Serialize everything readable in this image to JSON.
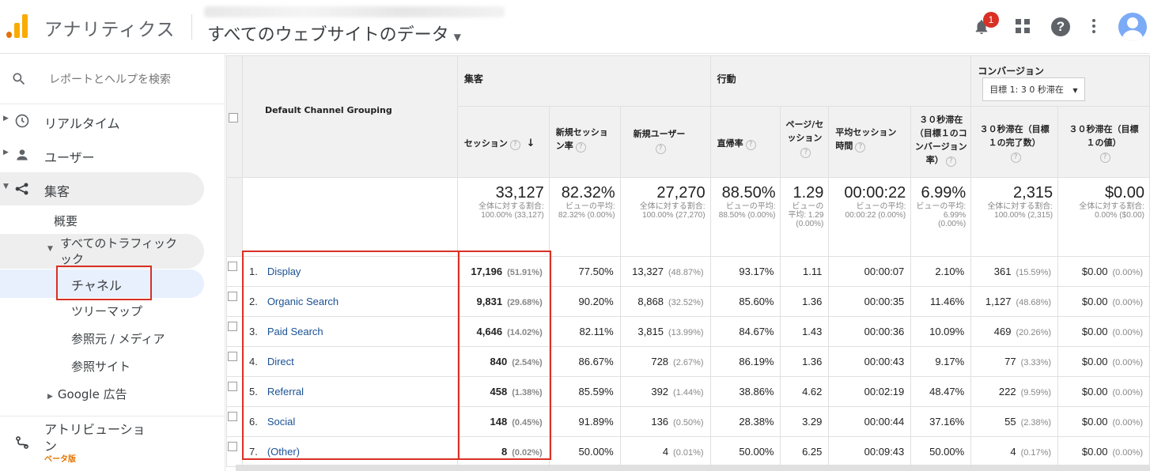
{
  "header": {
    "app_title": "アナリティクス",
    "property": "すべてのウェブサイトのデータ",
    "notification_count": "1"
  },
  "sidebar": {
    "search_placeholder": "レポートとヘルプを検索",
    "items": [
      {
        "label": "リアルタイム",
        "icon": "clock-icon"
      },
      {
        "label": "ユーザー",
        "icon": "person-icon"
      },
      {
        "label": "集客",
        "icon": "acquisition-icon"
      }
    ],
    "sub_items": {
      "overview": "概要",
      "all_traffic": "すべてのトラフィック",
      "all_traffic_2": "ック",
      "channels": "チャネル",
      "treemap": "ツリーマップ",
      "source_medium": "参照元 / メディア",
      "referrals": "参照サイト",
      "google_ads": "Google 広告"
    },
    "attribution": "アトリビューショ",
    "attribution_2": "ン",
    "beta": "ベータ版"
  },
  "table": {
    "dimension_header": "Default Channel Grouping",
    "group_acquisition": "集客",
    "group_behavior": "行動",
    "group_conversion": "コンバージョン",
    "goal_select": "目標 1: 3 0 秒滞在",
    "columns": [
      "セッション",
      "新規セッション率",
      "新規ユーザー",
      "直帰率",
      "ページ/セッション",
      "平均セッション時間",
      "３０秒滞在（目標１のコンバージョン率）",
      "３０秒滞在（目標１の完了数）",
      "３０秒滞在（目標１の値）"
    ],
    "totals": [
      {
        "big": "33,127",
        "small": "全体に対する割合: 100.00% (33,127)"
      },
      {
        "big": "82.32%",
        "small": "ビューの平均: 82.32% (0.00%)"
      },
      {
        "big": "27,270",
        "small": "全体に対する割合: 100.00% (27,270)"
      },
      {
        "big": "88.50%",
        "small": "ビューの平均: 88.50% (0.00%)"
      },
      {
        "big": "1.29",
        "small": "ビューの平均: 1.29 (0.00%)"
      },
      {
        "big": "00:00:22",
        "small": "ビューの平均: 00:00:22 (0.00%)"
      },
      {
        "big": "6.99%",
        "small": "ビューの平均: 6.99% (0.00%)"
      },
      {
        "big": "2,315",
        "small": "全体に対する割合: 100.00% (2,315)"
      },
      {
        "big": "$0.00",
        "small": "全体に対する割合: 0.00% ($0.00)"
      }
    ],
    "rows": [
      {
        "idx": "1.",
        "name": "Display",
        "sessions": "17,196",
        "sessions_pct": "(51.91%)",
        "new_sess_rate": "77.50%",
        "new_users": "13,327",
        "new_users_pct": "(48.87%)",
        "bounce": "93.17%",
        "pages": "1.11",
        "duration": "00:00:07",
        "conv_rate": "2.10%",
        "completions": "361",
        "completions_pct": "(15.59%)",
        "value": "$0.00",
        "value_pct": "(0.00%)"
      },
      {
        "idx": "2.",
        "name": "Organic Search",
        "sessions": "9,831",
        "sessions_pct": "(29.68%)",
        "new_sess_rate": "90.20%",
        "new_users": "8,868",
        "new_users_pct": "(32.52%)",
        "bounce": "85.60%",
        "pages": "1.36",
        "duration": "00:00:35",
        "conv_rate": "11.46%",
        "completions": "1,127",
        "completions_pct": "(48.68%)",
        "value": "$0.00",
        "value_pct": "(0.00%)"
      },
      {
        "idx": "3.",
        "name": "Paid Search",
        "sessions": "4,646",
        "sessions_pct": "(14.02%)",
        "new_sess_rate": "82.11%",
        "new_users": "3,815",
        "new_users_pct": "(13.99%)",
        "bounce": "84.67%",
        "pages": "1.43",
        "duration": "00:00:36",
        "conv_rate": "10.09%",
        "completions": "469",
        "completions_pct": "(20.26%)",
        "value": "$0.00",
        "value_pct": "(0.00%)"
      },
      {
        "idx": "4.",
        "name": "Direct",
        "sessions": "840",
        "sessions_pct": "(2.54%)",
        "new_sess_rate": "86.67%",
        "new_users": "728",
        "new_users_pct": "(2.67%)",
        "bounce": "86.19%",
        "pages": "1.36",
        "duration": "00:00:43",
        "conv_rate": "9.17%",
        "completions": "77",
        "completions_pct": "(3.33%)",
        "value": "$0.00",
        "value_pct": "(0.00%)"
      },
      {
        "idx": "5.",
        "name": "Referral",
        "sessions": "458",
        "sessions_pct": "(1.38%)",
        "new_sess_rate": "85.59%",
        "new_users": "392",
        "new_users_pct": "(1.44%)",
        "bounce": "38.86%",
        "pages": "4.62",
        "duration": "00:02:19",
        "conv_rate": "48.47%",
        "completions": "222",
        "completions_pct": "(9.59%)",
        "value": "$0.00",
        "value_pct": "(0.00%)"
      },
      {
        "idx": "6.",
        "name": "Social",
        "sessions": "148",
        "sessions_pct": "(0.45%)",
        "new_sess_rate": "91.89%",
        "new_users": "136",
        "new_users_pct": "(0.50%)",
        "bounce": "28.38%",
        "pages": "3.29",
        "duration": "00:00:44",
        "conv_rate": "37.16%",
        "completions": "55",
        "completions_pct": "(2.38%)",
        "value": "$0.00",
        "value_pct": "(0.00%)"
      },
      {
        "idx": "7.",
        "name": "(Other)",
        "sessions": "8",
        "sessions_pct": "(0.02%)",
        "new_sess_rate": "50.00%",
        "new_users": "4",
        "new_users_pct": "(0.01%)",
        "bounce": "50.00%",
        "pages": "6.25",
        "duration": "00:09:43",
        "conv_rate": "50.00%",
        "completions": "4",
        "completions_pct": "(0.17%)",
        "value": "$0.00",
        "value_pct": "(0.00%)"
      }
    ]
  },
  "colors": {
    "accent_orange": "#f9ab00",
    "highlight_red": "#d93025",
    "link_blue": "#1a5294"
  }
}
